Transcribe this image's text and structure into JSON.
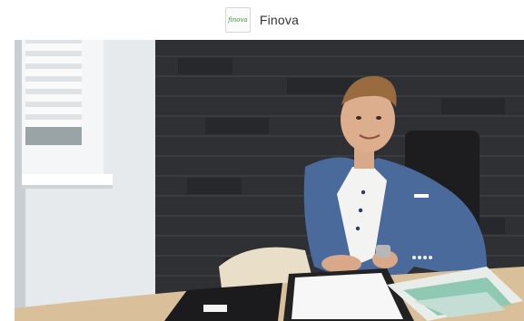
{
  "header": {
    "brand_name": "Finova",
    "logo_text": "finova"
  },
  "video": {
    "scene": "man-seated-at-desk",
    "colors": {
      "wall_stone": "#2e2f33",
      "wall_white": "#e9ecee",
      "jacket": "#4a6a9c",
      "desk": "#d9c09a"
    }
  }
}
